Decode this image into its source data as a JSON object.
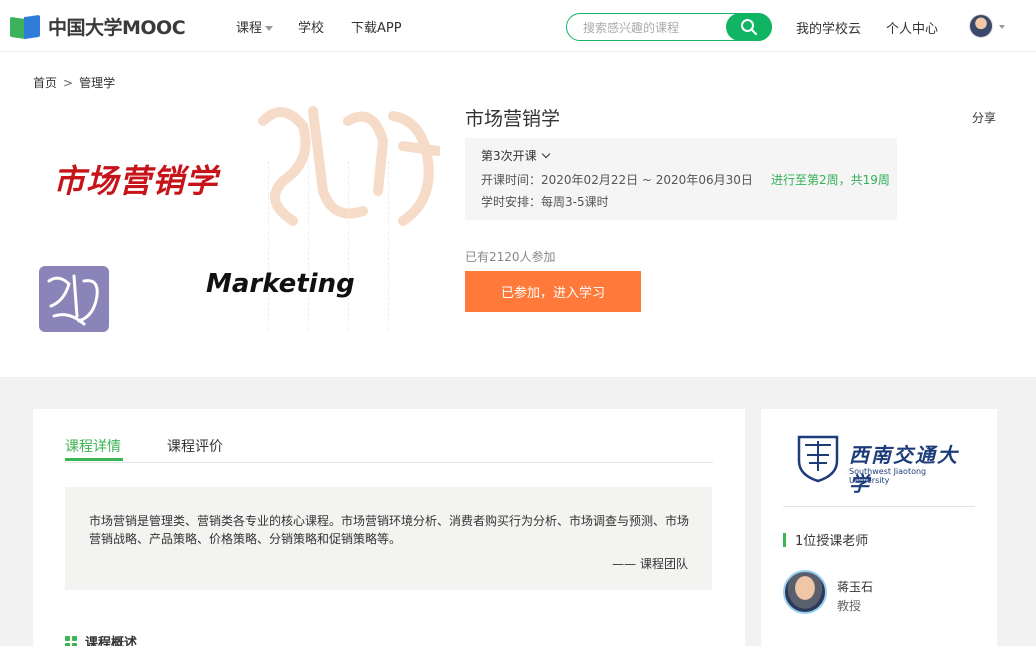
{
  "header": {
    "logo_text": "中国大学MOOC",
    "nav": {
      "courses": "课程",
      "schools": "学校",
      "download": "下载APP"
    },
    "search_placeholder": "搜索感兴趣的课程",
    "my_school_cloud": "我的学校云",
    "personal_center": "个人中心"
  },
  "breadcrumb": {
    "home": "首页",
    "separator": ">",
    "category": "管理学"
  },
  "course_image": {
    "cn_title": "市场营销学",
    "en_title": "Marketing"
  },
  "course": {
    "title": "市场营销学",
    "share": "分享",
    "term": "第3次开课",
    "time_label": "开课时间：",
    "time_value": "2020年02月22日 ~ 2020年06月30日",
    "progress": "进行至第2周，共19周",
    "hours_label": "学时安排：",
    "hours_value": "每周3-5课时",
    "enrolled": "已有2120人参加",
    "join_button": "已参加，进入学习"
  },
  "tabs": {
    "details": "课程详情",
    "reviews": "课程评价"
  },
  "description": {
    "text": "市场营销是管理类、营销类各专业的核心课程。市场营销环境分析、消费者购买行为分析、市场调查与预测、市场营销战略、产品策略、价格策略、分销策略和促销策略等。",
    "by": "—— 课程团队"
  },
  "overview_title": "课程概述",
  "school": {
    "name_cn": "西南交通大学",
    "name_en": "Southwest Jiaotong University"
  },
  "teachers": {
    "title": "1位授课老师",
    "list": [
      {
        "name": "蒋玉石",
        "role": "教授"
      }
    ]
  },
  "colors": {
    "brand_green": "#10b564",
    "accent_orange": "#ff7a3a",
    "tab_green": "#3cb554"
  }
}
